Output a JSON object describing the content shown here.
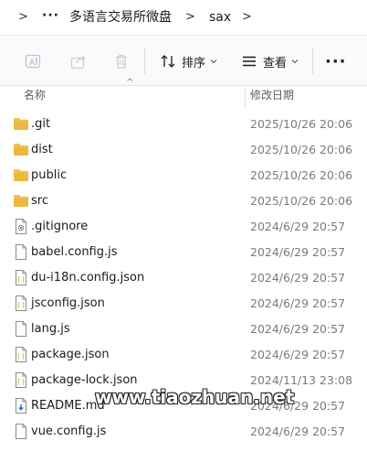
{
  "breadcrumb": {
    "items": [
      "多语言交易所微盘",
      "sax"
    ]
  },
  "toolbar": {
    "sort_label": "排序",
    "view_label": "查看"
  },
  "columns": {
    "name": "名称",
    "date_modified": "修改日期"
  },
  "files": [
    {
      "name": ".git",
      "date": "2025/10/26 20:06",
      "icon": "folder-icon"
    },
    {
      "name": "dist",
      "date": "2025/10/26 20:06",
      "icon": "folder-icon"
    },
    {
      "name": "public",
      "date": "2025/10/26 20:06",
      "icon": "folder-icon"
    },
    {
      "name": "src",
      "date": "2025/10/26 20:06",
      "icon": "folder-icon"
    },
    {
      "name": ".gitignore",
      "date": "2024/6/29 20:57",
      "icon": "settings-file-icon"
    },
    {
      "name": "babel.config.js",
      "date": "2024/6/29 20:57",
      "icon": "file-icon"
    },
    {
      "name": "du-i18n.config.json",
      "date": "2024/6/29 20:57",
      "icon": "json-file-icon"
    },
    {
      "name": "jsconfig.json",
      "date": "2024/6/29 20:57",
      "icon": "json-file-icon"
    },
    {
      "name": "lang.js",
      "date": "2024/6/29 20:57",
      "icon": "file-icon"
    },
    {
      "name": "package.json",
      "date": "2024/6/29 20:57",
      "icon": "json-file-icon"
    },
    {
      "name": "package-lock.json",
      "date": "2024/11/13 23:08",
      "icon": "json-file-icon"
    },
    {
      "name": "README.md",
      "date": "2024/6/29 20:57",
      "icon": "markdown-file-icon"
    },
    {
      "name": "vue.config.js",
      "date": "2024/6/29 20:57",
      "icon": "file-icon"
    }
  ],
  "watermark": "www.tiaozhuan.net",
  "colors": {
    "folder": "#f2c04a",
    "folder_dark": "#e3a92c",
    "json_icon": "#c9b84a",
    "markdown_icon": "#2f6fd1"
  }
}
